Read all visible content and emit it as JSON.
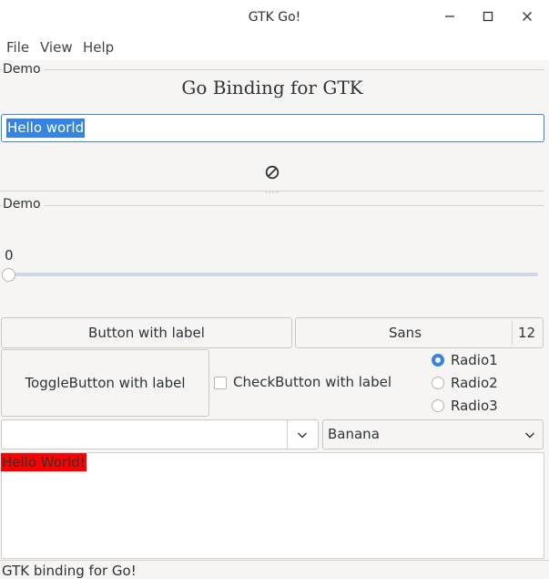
{
  "window": {
    "title": "GTK Go!"
  },
  "menu": {
    "file": "File",
    "view": "View",
    "help": "Help"
  },
  "frame1": {
    "label": "Demo",
    "heading": "Go Binding for GTK"
  },
  "entry": {
    "value": "Hello world"
  },
  "frame2": {
    "label": "Demo"
  },
  "scale": {
    "value_text": "0",
    "value": 0
  },
  "buttons": {
    "label_button": "Button with label",
    "font_name": "Sans",
    "font_size": "12",
    "toggle": "ToggleButton with label",
    "check": "CheckButton with label"
  },
  "radios": [
    {
      "label": "Radio1",
      "checked": true
    },
    {
      "label": "Radio2",
      "checked": false
    },
    {
      "label": "Radio3",
      "checked": false
    }
  ],
  "combo_entry": {
    "value": ""
  },
  "combo": {
    "selected": "Banana"
  },
  "textview": {
    "text": "Hello World!",
    "highlight_color": "#ff0000"
  },
  "statusbar": {
    "text": "GTK binding for Go!"
  },
  "colors": {
    "accent": "#3584e4",
    "window_bg": "#f6f5f4"
  },
  "icons": {
    "minimize": "minimize-icon",
    "maximize": "maximize-icon",
    "close": "close-icon",
    "spinner": "no-entry-icon",
    "dropdown": "chevron-down-icon"
  }
}
